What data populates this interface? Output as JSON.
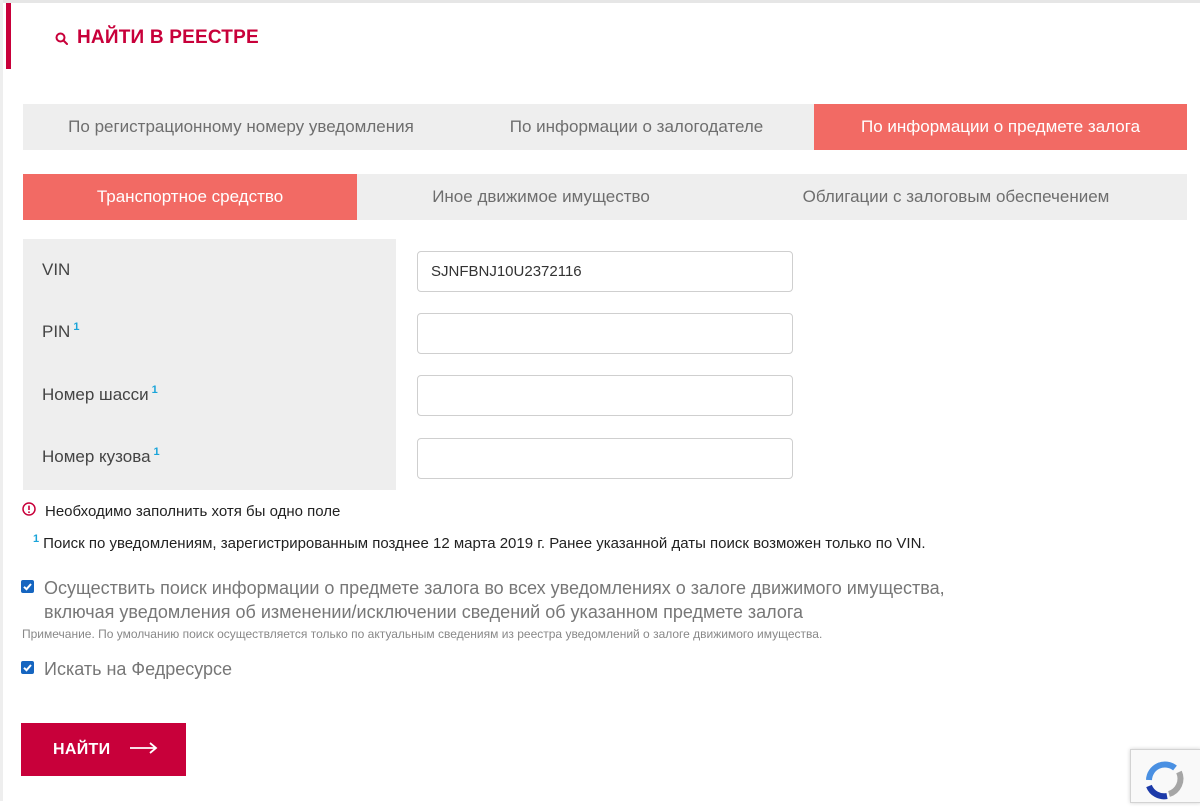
{
  "header": {
    "title": "НАЙТИ В РЕЕСТРЕ"
  },
  "main_tabs": [
    {
      "label": "По регистрационному номеру уведомления",
      "active": false
    },
    {
      "label": "По информации о залогодателе",
      "active": false
    },
    {
      "label": "По информации о предмете залога",
      "active": true
    }
  ],
  "sub_tabs": [
    {
      "label": "Транспортное средство",
      "active": true
    },
    {
      "label": "Иное движимое имущество",
      "active": false
    },
    {
      "label": "Облигации с залоговым обеспечением",
      "active": false
    }
  ],
  "fields": [
    {
      "label": "VIN",
      "sup": "",
      "value": "SJNFBNJ10U2372116",
      "placeholder": ""
    },
    {
      "label": "PIN",
      "sup": "1",
      "value": "",
      "placeholder": ""
    },
    {
      "label": "Номер шасси",
      "sup": "1",
      "value": "",
      "placeholder": ""
    },
    {
      "label": "Номер кузова",
      "sup": "1",
      "value": "",
      "placeholder": ""
    }
  ],
  "validation_message": "Необходимо заполнить хотя бы одно поле",
  "footnote": {
    "marker": "1",
    "text": "Поиск по уведомлениям, зарегистрированным позднее 12 марта 2019 г. Ранее указанной даты поиск возможен только по VIN."
  },
  "options": [
    {
      "line1": "Осуществить поиск информации о предмете залога во всех уведомлениях о залоге движимого имущества,",
      "line2": "включая уведомления об изменении/исключении сведений об указанном предмете залога",
      "checked": true
    },
    {
      "label": "Искать на Федресурсе",
      "checked": true
    }
  ],
  "option_note": "Примечание. По умолчанию поиск осуществляется только по актуальным сведениям из реестра уведомлений о залоге движимого имущества.",
  "submit_label": "НАЙТИ",
  "colors": {
    "brand": "#c8003a",
    "active_tab": "#f26a64",
    "tab_bg": "#eeeeee",
    "footnote_marker": "#1aa4d9",
    "checkbox": "#1565c0"
  }
}
